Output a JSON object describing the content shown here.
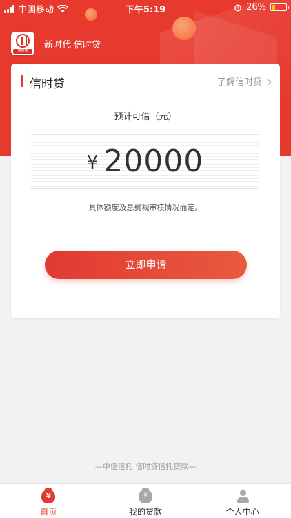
{
  "status_bar": {
    "carrier": "中国移动",
    "time": "下午5:19",
    "battery_text": "26%"
  },
  "header": {
    "brand_text": "新时代  信时贷",
    "logo_tag": "信时贷"
  },
  "card": {
    "title": "信时贷",
    "link_text": "了解信时贷",
    "amount_label": "预计可借（元）",
    "currency_symbol": "¥",
    "amount": "20000",
    "note": "具体额度及息费视审核情况而定。",
    "apply_button": "立即申请"
  },
  "footer_note": "—中信信托  信时贷信托贷款—",
  "tabs": [
    {
      "label": "首页",
      "icon": "money-bag-icon",
      "active": true,
      "icon_glyph": "¥"
    },
    {
      "label": "我的贷款",
      "icon": "loan-bag-icon",
      "active": false,
      "icon_glyph": "¥"
    },
    {
      "label": "个人中心",
      "icon": "person-icon",
      "active": false
    }
  ],
  "colors": {
    "primary_red": "#e13a31",
    "battery_yellow": "#ffd000"
  }
}
